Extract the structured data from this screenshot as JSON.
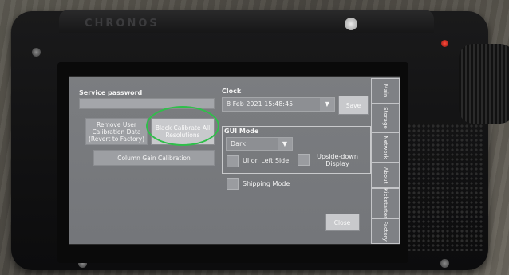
{
  "device": {
    "brand": "CHRONOS"
  },
  "service": {
    "password_label": "Service password",
    "password_value": "",
    "remove_calibration_label": "Remove User Calibration Data (Revert to Factory)",
    "black_calibrate_label": "Black Calibrate All Resolutions",
    "column_gain_label": "Column Gain Calibration"
  },
  "clock": {
    "label": "Clock",
    "value": "8 Feb 2021 15:48:45",
    "save_label": "Save"
  },
  "gui_mode": {
    "label": "GUI Mode",
    "selected": "Dark",
    "ui_left_label": "UI on Left Side",
    "upside_down_label": "Upside-down Display"
  },
  "shipping_mode_label": "Shipping Mode",
  "close_label": "Close",
  "tabs": [
    "Main",
    "Storage",
    "Network",
    "About",
    "Kickstarter",
    "Factory"
  ],
  "icons": {
    "dropdown": "chevron-down-icon"
  },
  "colors": {
    "highlight_circle": "#2fbf4a",
    "led": "#ff4a3a"
  }
}
